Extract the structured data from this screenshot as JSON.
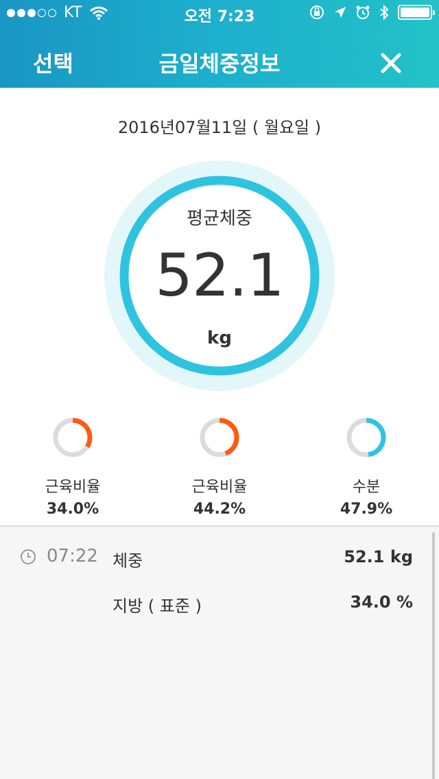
{
  "status_bar": {
    "carrier": "KT",
    "time": "오전 7:23"
  },
  "nav": {
    "left_label": "선택",
    "title": "금일체중정보"
  },
  "date": "2016년07월11일 ( 월요일 )",
  "main_gauge": {
    "label": "평균체중",
    "value": "52.1",
    "unit": "kg",
    "color": "#2ec4e0",
    "halo_color": "#e3f6fa"
  },
  "metrics": [
    {
      "label": "근육비율",
      "value": "34.0%",
      "fraction": 0.34,
      "color": "#ff5a14"
    },
    {
      "label": "근육비율",
      "value": "44.2%",
      "fraction": 0.442,
      "color": "#ff5a14"
    },
    {
      "label": "수분",
      "value": "47.9%",
      "fraction": 0.479,
      "color": "#2ec4e0"
    }
  ],
  "history": {
    "time": "07:22",
    "rows": [
      {
        "label": "체중",
        "value": "52.1 kg"
      },
      {
        "label": "지방 ( 표준 )",
        "value": "34.0 %"
      }
    ]
  }
}
